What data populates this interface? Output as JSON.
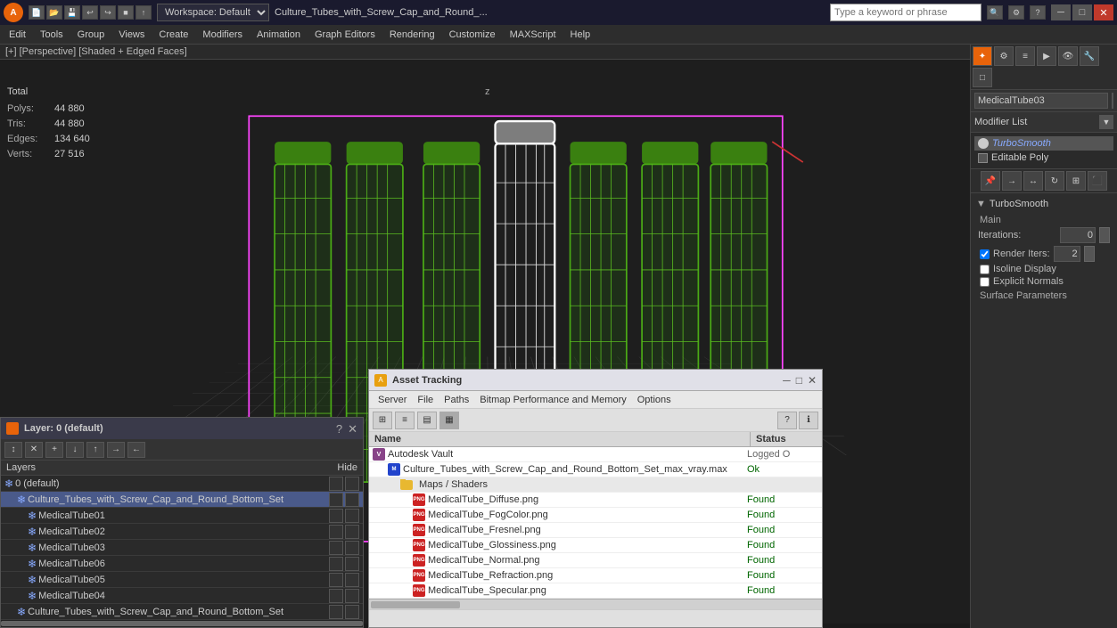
{
  "titlebar": {
    "logo": "A",
    "workspace": "Workspace: Default",
    "doc_title": "Culture_Tubes_with_Screw_Cap_and_Round_...",
    "search_placeholder": "Type a keyword or phrase",
    "btn_minimize": "─",
    "btn_maximize": "□",
    "btn_close": "✕"
  },
  "menubar": {
    "items": [
      "Edit",
      "Tools",
      "Group",
      "Views",
      "Create",
      "Modifiers",
      "Animation",
      "Graph Editors",
      "Rendering",
      "Customize",
      "MAXScript",
      "Help"
    ]
  },
  "viewport": {
    "header": "[+] [Perspective] [Shaded + Edged Faces]",
    "stats": {
      "header": "Total",
      "polys_label": "Polys:",
      "polys_val": "44 880",
      "tris_label": "Tris:",
      "tris_val": "44 880",
      "edges_label": "Edges:",
      "edges_val": "134 640",
      "verts_label": "Verts:",
      "verts_val": "27 516"
    },
    "axis_z": "z"
  },
  "right_panel": {
    "object_name": "MedicalTube03",
    "modifier_list_label": "Modifier List",
    "modifiers": [
      {
        "name": "TurboSmooth",
        "active": true
      },
      {
        "name": "Editable Poly",
        "active": false
      }
    ],
    "turbosmooth_title": "TurboSmooth",
    "main_section": "Main",
    "iterations_label": "Iterations:",
    "iterations_val": "0",
    "render_iters_label": "Render Iters:",
    "render_iters_val": "2",
    "isoline_display": "Isoline Display",
    "explicit_normals": "Explicit Normals",
    "surface_parameters": "Surface Parameters"
  },
  "layer_panel": {
    "title": "Layer: 0 (default)",
    "close_btn": "✕",
    "question_btn": "?",
    "layers_header": "Layers",
    "hide_header": "Hide",
    "items": [
      {
        "indent": 0,
        "name": "0 (default)",
        "type": "layer",
        "selected": false
      },
      {
        "indent": 1,
        "name": "Culture_Tubes_with_Screw_Cap_and_Round_Bottom_Set",
        "type": "object",
        "selected": true
      },
      {
        "indent": 2,
        "name": "MedicalTube01",
        "type": "object",
        "selected": false
      },
      {
        "indent": 2,
        "name": "MedicalTube02",
        "type": "object",
        "selected": false
      },
      {
        "indent": 2,
        "name": "MedicalTube03",
        "type": "object",
        "selected": false
      },
      {
        "indent": 2,
        "name": "MedicalTube06",
        "type": "object",
        "selected": false
      },
      {
        "indent": 2,
        "name": "MedicalTube05",
        "type": "object",
        "selected": false
      },
      {
        "indent": 2,
        "name": "MedicalTube04",
        "type": "object",
        "selected": false
      },
      {
        "indent": 1,
        "name": "Culture_Tubes_with_Screw_Cap_and_Round_Bottom_Set",
        "type": "object",
        "selected": false
      }
    ]
  },
  "asset_panel": {
    "title": "Asset Tracking",
    "menu": [
      "Server",
      "File",
      "Paths",
      "Bitmap Performance and Memory",
      "Options"
    ],
    "table_header_name": "Name",
    "table_header_status": "Status",
    "rows": [
      {
        "indent": 0,
        "icon": "vault",
        "name": "Autodesk Vault",
        "status": "Logged O",
        "type": "vault"
      },
      {
        "indent": 1,
        "icon": "max",
        "name": "Culture_Tubes_with_Screw_Cap_and_Round_Bottom_Set_max_vray.max",
        "status": "Ok",
        "type": "max"
      },
      {
        "indent": 2,
        "icon": "folder",
        "name": "Maps / Shaders",
        "status": "",
        "type": "folder"
      },
      {
        "indent": 3,
        "icon": "png",
        "name": "MedicalTube_Diffuse.png",
        "status": "Found",
        "type": "png"
      },
      {
        "indent": 3,
        "icon": "png",
        "name": "MedicalTube_FogColor.png",
        "status": "Found",
        "type": "png"
      },
      {
        "indent": 3,
        "icon": "png",
        "name": "MedicalTube_Fresnel.png",
        "status": "Found",
        "type": "png"
      },
      {
        "indent": 3,
        "icon": "png",
        "name": "MedicalTube_Glossiness.png",
        "status": "Found",
        "type": "png"
      },
      {
        "indent": 3,
        "icon": "png",
        "name": "MedicalTube_Normal.png",
        "status": "Found",
        "type": "png"
      },
      {
        "indent": 3,
        "icon": "png",
        "name": "MedicalTube_Refraction.png",
        "status": "Found",
        "type": "png"
      },
      {
        "indent": 3,
        "icon": "png",
        "name": "MedicalTube_Specular.png",
        "status": "Found",
        "type": "png"
      }
    ]
  }
}
